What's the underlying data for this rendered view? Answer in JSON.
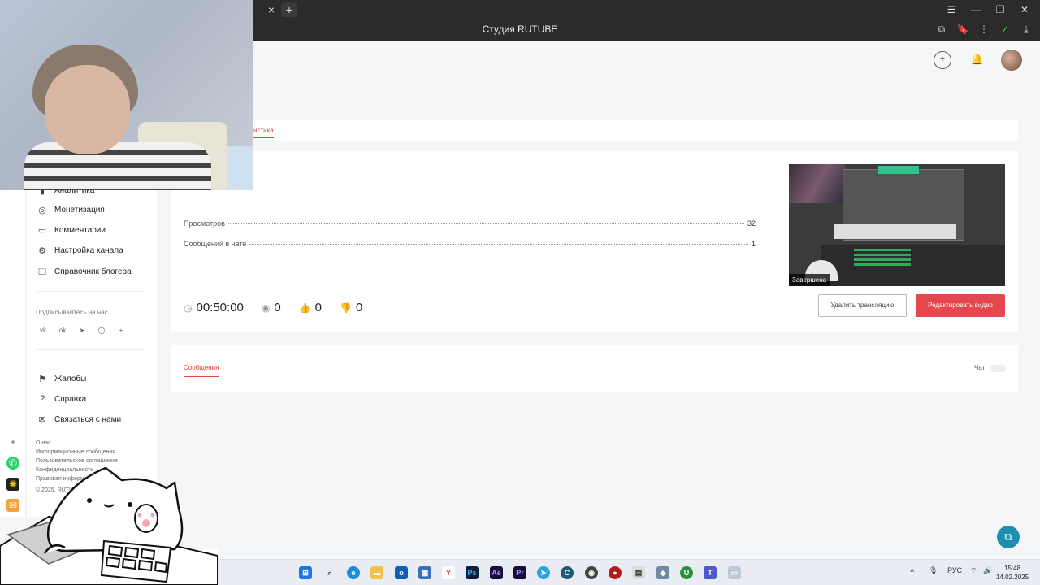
{
  "browser": {
    "tab_close": "×",
    "tab_new": "+",
    "title": "Студия RUTUBE",
    "window_controls": [
      "☰",
      "—",
      "❐",
      "✕"
    ],
    "addr_icons": [
      "⧉",
      "🔖",
      "⋮",
      "✓",
      "⤓"
    ]
  },
  "header": {
    "upload_icon": "+",
    "bell_icon": "🔔"
  },
  "tabs": {
    "active": "истика"
  },
  "stream": {
    "stats": [
      {
        "label": "Просмотров",
        "value": "32"
      },
      {
        "label": "Сообщений в чате",
        "value": "1"
      }
    ],
    "thumbnail_status": "Завершена",
    "metrics": {
      "duration": "00:50:00",
      "viewers": "0",
      "likes": "0",
      "dislikes": "0"
    },
    "delete_label": "Удалить трансляцию",
    "edit_label": "Редактировать видео"
  },
  "messages": {
    "tab_label": "Сообщения",
    "chat_label": "Чат"
  },
  "sidebar": {
    "items": [
      {
        "label": "Аналитика",
        "icon": "▮"
      },
      {
        "label": "Монетизация",
        "icon": "◎"
      },
      {
        "label": "Комментарии",
        "icon": "▭"
      },
      {
        "label": "Настройка канала",
        "icon": "⚙"
      },
      {
        "label": "Справочник блогера",
        "icon": "❏"
      }
    ],
    "subscribe_label": "Подписывайтесь на нас",
    "socials": [
      "vk",
      "ok",
      "➤",
      "◯",
      "+"
    ],
    "support": [
      {
        "label": "Жалобы",
        "icon": "⚑"
      },
      {
        "label": "Справка",
        "icon": "?"
      },
      {
        "label": "Связаться с нами",
        "icon": "✉"
      }
    ],
    "footer_links": [
      "О нас",
      "Информационные сообщения",
      "Пользовательское соглашение",
      "Конфиденциальность",
      "Правовая информация",
      "© 2025, RUTUBE"
    ]
  },
  "taskbar": {
    "tray_lang": "РУС",
    "time": "15:48",
    "date": "14.02.2025"
  },
  "colors": {
    "accent": "#e5474e",
    "help": "#1f8fb0"
  }
}
